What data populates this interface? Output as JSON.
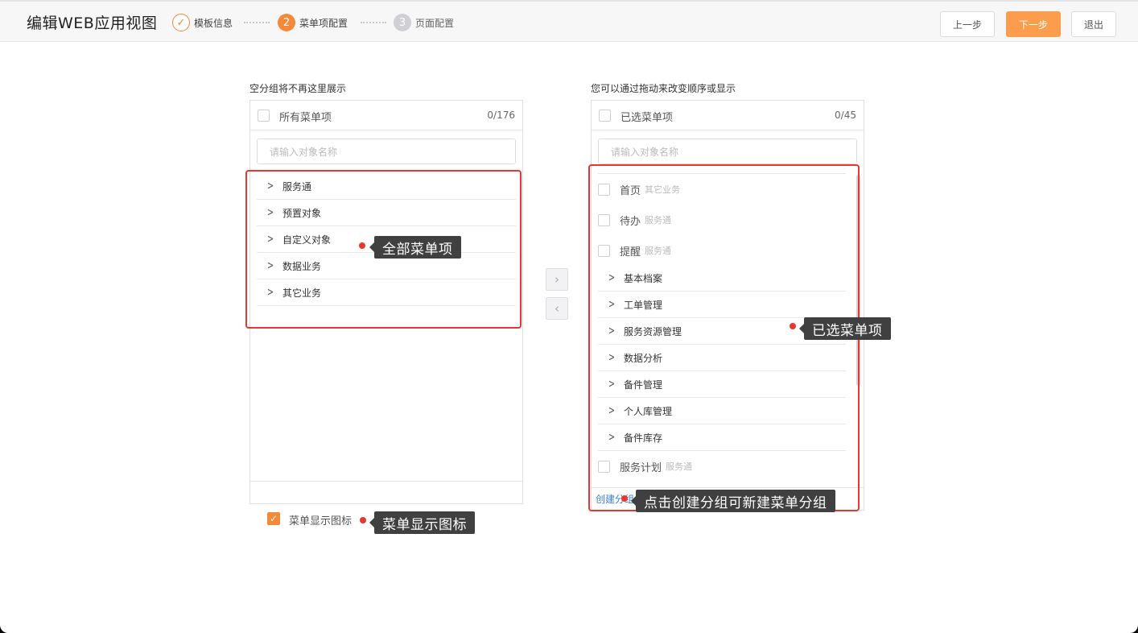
{
  "header": {
    "title": "编辑WEB应用视图",
    "steps": [
      {
        "number": "",
        "label": "模板信息",
        "state": "done"
      },
      {
        "number": "2",
        "label": "菜单项配置",
        "state": "active"
      },
      {
        "number": "3",
        "label": "页面配置",
        "state": "todo"
      }
    ],
    "buttons": {
      "prev": "上一步",
      "next": "下一步",
      "exit": "退出"
    }
  },
  "left_panel": {
    "caption": "空分组将不再这里展示",
    "header_label": "所有菜单项",
    "count": "0/176",
    "search_placeholder": "请输入对象名称",
    "groups": [
      "服务通",
      "预置对象",
      "自定义对象",
      "数据业务",
      "其它业务"
    ]
  },
  "right_panel": {
    "caption": "您可以通过拖动来改变顺序或显示",
    "header_label": "已选菜单项",
    "count": "0/45",
    "search_placeholder": "请输入对象名称",
    "items_top": [
      {
        "label": "首页",
        "tag": "其它业务"
      },
      {
        "label": "待办",
        "tag": "服务通"
      },
      {
        "label": "提醒",
        "tag": "服务通"
      }
    ],
    "groups": [
      "基本档案",
      "工单管理",
      "服务资源管理",
      "数据分析",
      "备件管理",
      "个人库管理",
      "备件库存"
    ],
    "items_bottom": [
      {
        "label": "服务计划",
        "tag": "服务通"
      }
    ],
    "create_group_link": "创建分组"
  },
  "options": {
    "show_menu_icon_label": "菜单显示图标",
    "show_menu_icon_checked": true
  },
  "annotations": {
    "all_items": "全部菜单项",
    "selected_items": "已选菜单项",
    "create_group": "点击创建分组可新建菜单分组",
    "show_icon": "菜单显示图标"
  },
  "colors": {
    "accent": "#f5893a",
    "annotation_red": "#e8372f",
    "link_blue": "#3d7fd9"
  }
}
